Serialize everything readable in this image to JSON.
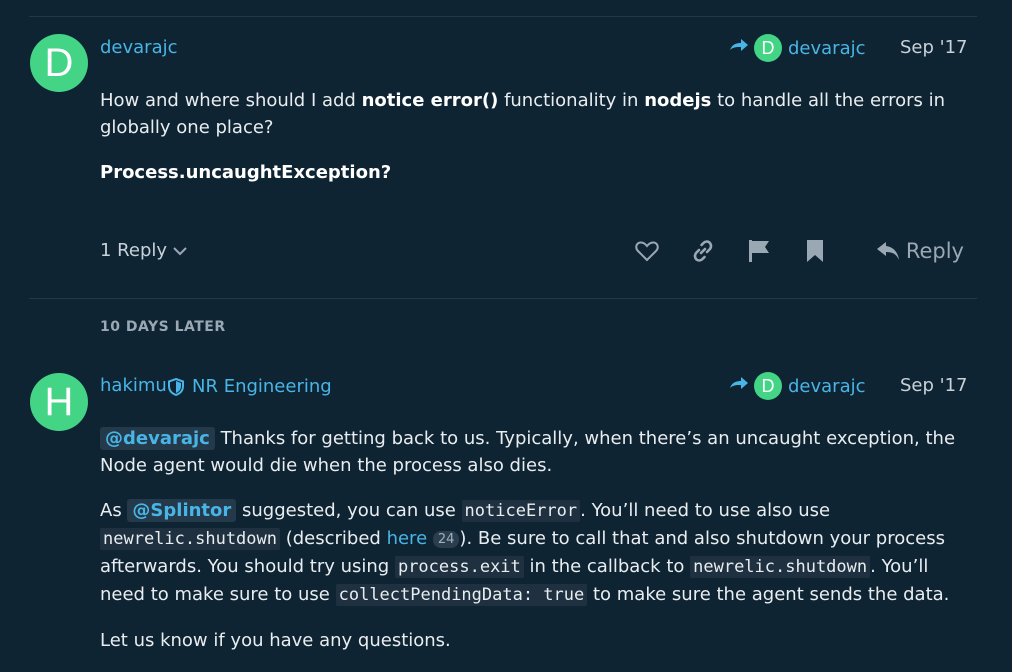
{
  "post1": {
    "avatar_letter": "D",
    "username": "devarajc",
    "reply_to": {
      "avatar_letter": "D",
      "username": "devarajc"
    },
    "date": "Sep '17",
    "body": {
      "p1_a": "How and where should I add ",
      "p1_b": "notice error()",
      "p1_c": " functionality in ",
      "p1_d": "nodejs",
      "p1_e": " to handle all the errors in globally one place?",
      "p2": "Process.uncaughtException?"
    },
    "replies_label": "1 Reply",
    "actions": {
      "like": "heart-icon",
      "share": "link-icon",
      "flag": "flag-icon",
      "bookmark": "bookmark-icon",
      "reply_label": "Reply"
    }
  },
  "time_gap": "10 DAYS LATER",
  "post2": {
    "avatar_letter": "H",
    "username": "hakimu",
    "group": "NR Engineering",
    "reply_to": {
      "avatar_letter": "D",
      "username": "devarajc"
    },
    "date": "Sep '17",
    "body": {
      "p1_mention": "@devarajc",
      "p1_text": " Thanks for getting back to us. Typically, when there’s an uncaught exception, the Node agent would die when the process also dies.",
      "p2_a": "As ",
      "p2_mention": "@Splintor",
      "p2_b": " suggested, you can use ",
      "p2_code1": "noticeError",
      "p2_c": ". You’ll need to use also use ",
      "p2_code2": "newrelic.shutdown",
      "p2_d": " (described ",
      "p2_link": "here",
      "p2_badge": "24",
      "p2_e": "). Be sure to call that and also shutdown your process afterwards. You should try using ",
      "p2_code3": "process.exit",
      "p2_f": " in the callback to ",
      "p2_code4": "newrelic.shutdown",
      "p2_g": ". You’ll need to make sure to use ",
      "p2_code5": "collectPendingData: true",
      "p2_h": " to make sure the agent sends the data.",
      "p3": "Let us know if you have any questions."
    }
  },
  "colors": {
    "background": "#0f2433",
    "accent": "#48b5e6",
    "avatar": "#43d486"
  }
}
